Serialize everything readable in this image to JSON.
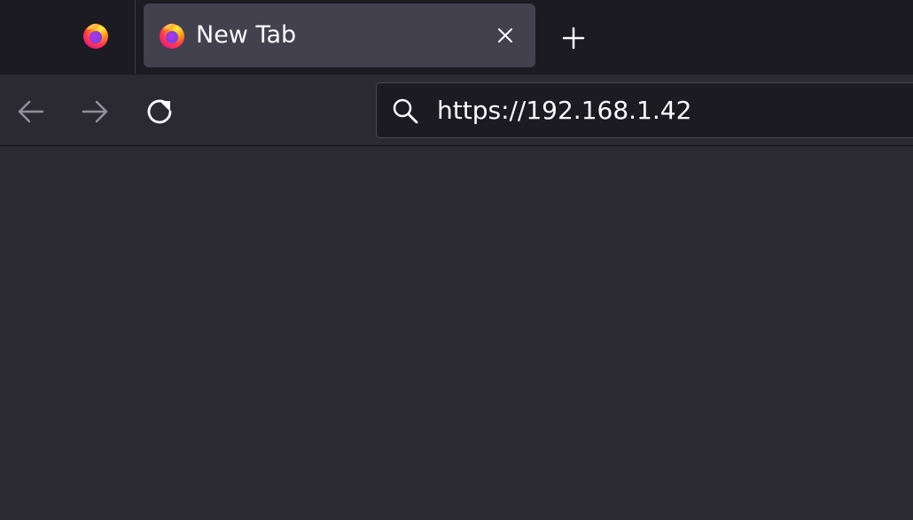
{
  "tabs": {
    "active": {
      "title": "New Tab"
    }
  },
  "toolbar": {
    "url": "https://192.168.1.42"
  },
  "icons": {
    "pinned_tab": "firefox-logo-icon",
    "tab": "firefox-logo-icon",
    "close": "close-icon",
    "new_tab": "plus-icon",
    "back": "arrow-left-icon",
    "forward": "arrow-right-icon",
    "reload": "reload-icon",
    "search": "search-icon"
  },
  "colors": {
    "tabbar_bg": "#1c1b22",
    "active_tab_bg": "#42414d",
    "toolbar_bg": "#2b2a33",
    "urlbar_bg": "#1c1b22",
    "text": "#fbfbfe",
    "disabled_icon": "#8f8f9d"
  }
}
